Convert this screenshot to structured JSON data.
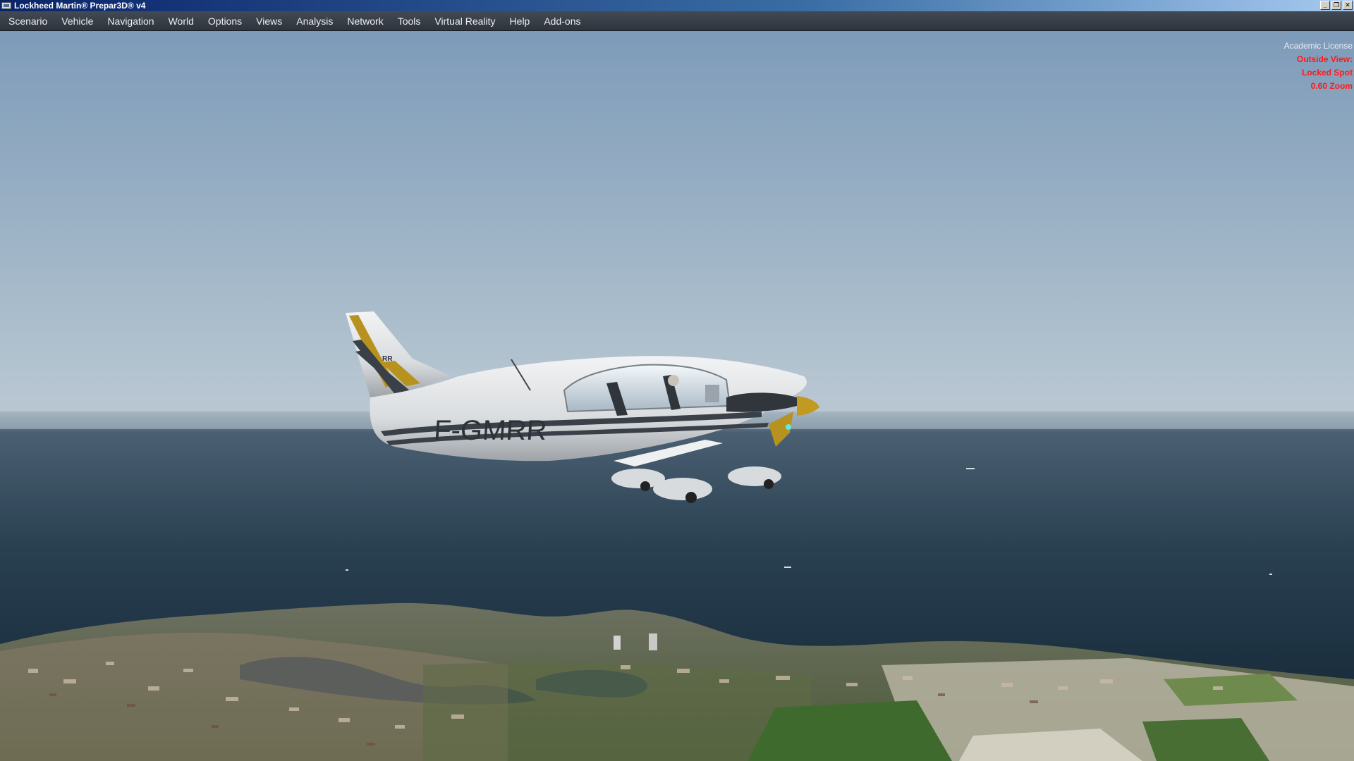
{
  "window": {
    "title": "Lockheed Martin® Prepar3D® v4",
    "buttons": {
      "minimize": "_",
      "restore": "❐",
      "close": "✕"
    }
  },
  "menu": {
    "items": [
      "Scenario",
      "Vehicle",
      "Navigation",
      "World",
      "Options",
      "Views",
      "Analysis",
      "Network",
      "Tools",
      "Virtual Reality",
      "Help",
      "Add-ons"
    ]
  },
  "overlay": {
    "license": "Academic License",
    "view_lines": [
      "Outside View:",
      "Locked Spot",
      "0.60 Zoom"
    ]
  },
  "aircraft": {
    "registration": "F-GMRR",
    "tail_code": "RR"
  },
  "colors": {
    "sky_top": "#7d9bb9",
    "sky_horizon": "#b8c8d4",
    "sea": "#1f3546",
    "fuselage": "#e4e6e8",
    "stripe_dark": "#3a4048",
    "stripe_gold": "#b8921e",
    "hud_red": "#ff1a1a"
  }
}
